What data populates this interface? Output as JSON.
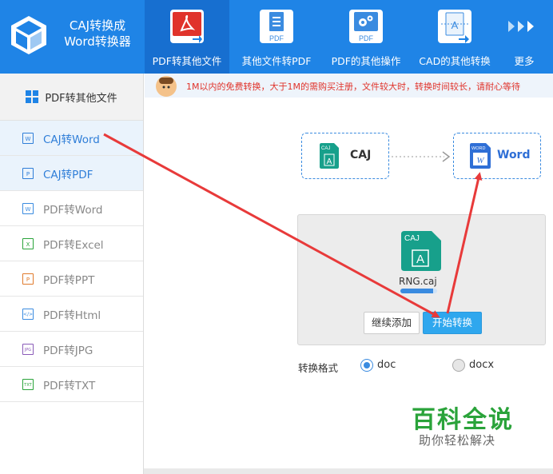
{
  "app": {
    "title_line1": "CAJ转换成",
    "title_line2": "Word转换器"
  },
  "nav": [
    {
      "label": "PDF转其他文件",
      "icon": "pdf-acrobat-icon",
      "color": "#e0332b"
    },
    {
      "label": "其他文件转PDF",
      "icon": "doc-to-pdf-icon",
      "color": "#3a8be0"
    },
    {
      "label": "PDF的其他操作",
      "icon": "pdf-gear-icon",
      "color": "#3a8be0"
    },
    {
      "label": "CAD的其他转换",
      "icon": "cad-icon",
      "color": "#3a8be0"
    },
    {
      "label": "更多",
      "icon": "more-arrows-icon"
    }
  ],
  "nav_icon_texts": {
    "pdf": "PDF"
  },
  "sidebar": {
    "header": "PDF转其他文件",
    "items": [
      {
        "label": "CAJ转Word",
        "icon": "W",
        "selected": true
      },
      {
        "label": "CAJ转PDF",
        "icon": "P",
        "selected": true
      },
      {
        "label": "PDF转Word",
        "icon": "W",
        "selected": false
      },
      {
        "label": "PDF转Excel",
        "icon": "X",
        "selected": false
      },
      {
        "label": "PDF转PPT",
        "icon": "P",
        "selected": false
      },
      {
        "label": "PDF转Html",
        "icon": "</>",
        "selected": false
      },
      {
        "label": "PDF转JPG",
        "icon": "JPG",
        "selected": false
      },
      {
        "label": "PDF转TXT",
        "icon": "TXT",
        "selected": false
      }
    ]
  },
  "notice": "1M以内的免费转换，大于1M的需购买注册，文件较大时，转换时间较长，请耐心等待",
  "conversion": {
    "from_badge": "CAJ",
    "from_label": "CAJ",
    "from_glyph": "A",
    "to_badge": "WORD",
    "to_label": "Word",
    "to_glyph": "W"
  },
  "file": {
    "badge": "CAJ",
    "glyph": "A",
    "name": "RNG.caj",
    "progress": 0.9
  },
  "buttons": {
    "add_more": "继续添加",
    "start": "开始转换"
  },
  "format": {
    "label": "转换格式",
    "options": [
      "doc",
      "docx"
    ],
    "selected": "doc"
  },
  "watermark": {
    "line1": "百科全说",
    "line2": "助你轻松解决"
  },
  "colors": {
    "brand_blue": "#1f84e6",
    "accent": "#3a8be0",
    "caj_green": "#17a08b",
    "arrow_red": "#e83a3a",
    "start_button": "#2fa7ee"
  }
}
